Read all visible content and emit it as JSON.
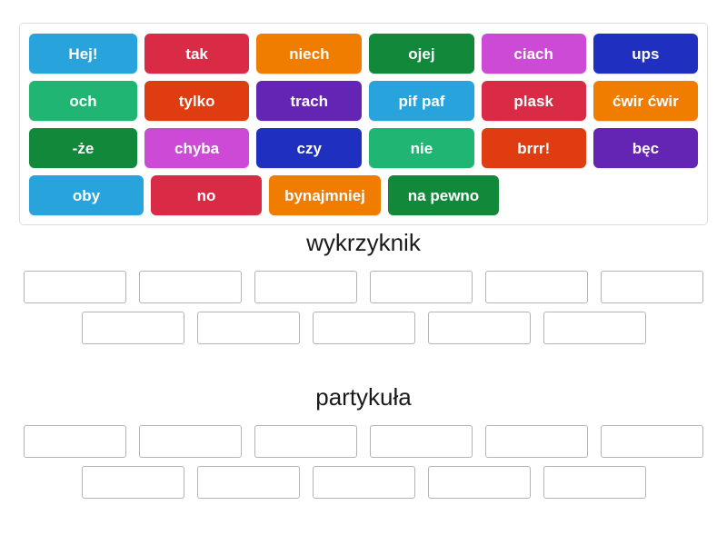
{
  "word_bank": {
    "name": "word-bank",
    "rows": [
      [
        {
          "label": "Hej!",
          "color": "#29a3dc",
          "width": 126
        },
        {
          "label": "tak",
          "color": "#d92b45",
          "width": 122
        },
        {
          "label": "niech",
          "color": "#f07c00",
          "width": 123
        },
        {
          "label": "ojej",
          "color": "#12883b",
          "width": 122
        },
        {
          "label": "ciach",
          "color": "#cc4ad6",
          "width": 122
        },
        {
          "label": "ups",
          "color": "#1f2fc0",
          "width": 122
        }
      ],
      [
        {
          "label": "och",
          "color": "#21b573",
          "width": 126
        },
        {
          "label": "tylko",
          "color": "#df3c12",
          "width": 122
        },
        {
          "label": "trach",
          "color": "#6424b4",
          "width": 123
        },
        {
          "label": "pif paf",
          "color": "#29a3dc",
          "width": 122
        },
        {
          "label": "plask",
          "color": "#d92b45",
          "width": 122
        },
        {
          "label": "ćwir ćwir",
          "color": "#f07c00",
          "width": 122
        }
      ],
      [
        {
          "label": "-że",
          "color": "#12883b",
          "width": 126
        },
        {
          "label": "chyba",
          "color": "#cc4ad6",
          "width": 122
        },
        {
          "label": "czy",
          "color": "#1f2fc0",
          "width": 123
        },
        {
          "label": "nie",
          "color": "#21b573",
          "width": 122
        },
        {
          "label": "brrr!",
          "color": "#df3c12",
          "width": 122
        },
        {
          "label": "bęc",
          "color": "#6424b4",
          "width": 122
        }
      ],
      [
        {
          "label": "oby",
          "color": "#29a3dc",
          "width": 126
        },
        {
          "label": "no",
          "color": "#d92b45",
          "width": 122
        },
        {
          "label": "bynajmniej",
          "color": "#f07c00",
          "width": 123
        },
        {
          "label": "na pewno",
          "color": "#12883b",
          "width": 122
        }
      ]
    ]
  },
  "categories": [
    {
      "title": "wykrzyknik",
      "slot_rows": [
        {
          "count": 6,
          "widths": [
            113,
            113,
            113,
            113,
            113,
            113
          ]
        },
        {
          "count": 5,
          "widths": [
            113,
            113,
            113,
            113,
            113
          ]
        }
      ]
    },
    {
      "title": "partykuła",
      "slot_rows": [
        {
          "count": 6,
          "widths": [
            113,
            113,
            113,
            113,
            113,
            113
          ]
        },
        {
          "count": 5,
          "widths": [
            113,
            113,
            113,
            113,
            113
          ]
        }
      ]
    }
  ],
  "style": {
    "panel_border": "#dcdcdc",
    "slot_border": "#b4b4b4",
    "text_color": "#ffffff",
    "title_color": "#1a1a1a",
    "background": "#ffffff"
  }
}
